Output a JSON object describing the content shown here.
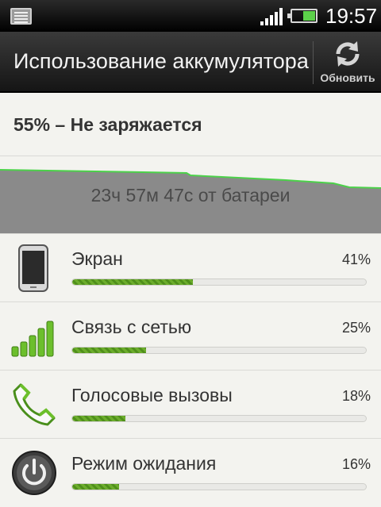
{
  "status_bar": {
    "time": "19:57",
    "notification_icon": "notes-icon",
    "signal_icon": "signal-bars-icon",
    "battery_icon": "battery-icon",
    "battery_level": 0.55
  },
  "header": {
    "title": "Использование аккумулятора",
    "refresh_label": "Обновить",
    "refresh_icon": "refresh-icon"
  },
  "battery_summary": {
    "status": "55% – Не заряжается",
    "duration_on_battery": "23ч 57м 47с от батареи"
  },
  "usage": [
    {
      "name": "Экран",
      "percent_label": "41%",
      "percent": 41,
      "icon": "phone-screen-icon"
    },
    {
      "name": "Связь с сетью",
      "percent_label": "25%",
      "percent": 25,
      "icon": "signal-bars-icon"
    },
    {
      "name": "Голосовые вызовы",
      "percent_label": "18%",
      "percent": 18,
      "icon": "phone-handset-icon"
    },
    {
      "name": "Режим ожидания",
      "percent_label": "16%",
      "percent": 16,
      "icon": "power-icon"
    }
  ],
  "colors": {
    "accent_green": "#5cb82e",
    "graph_fill": "#8a8a8a",
    "graph_line": "#4cd14a"
  }
}
